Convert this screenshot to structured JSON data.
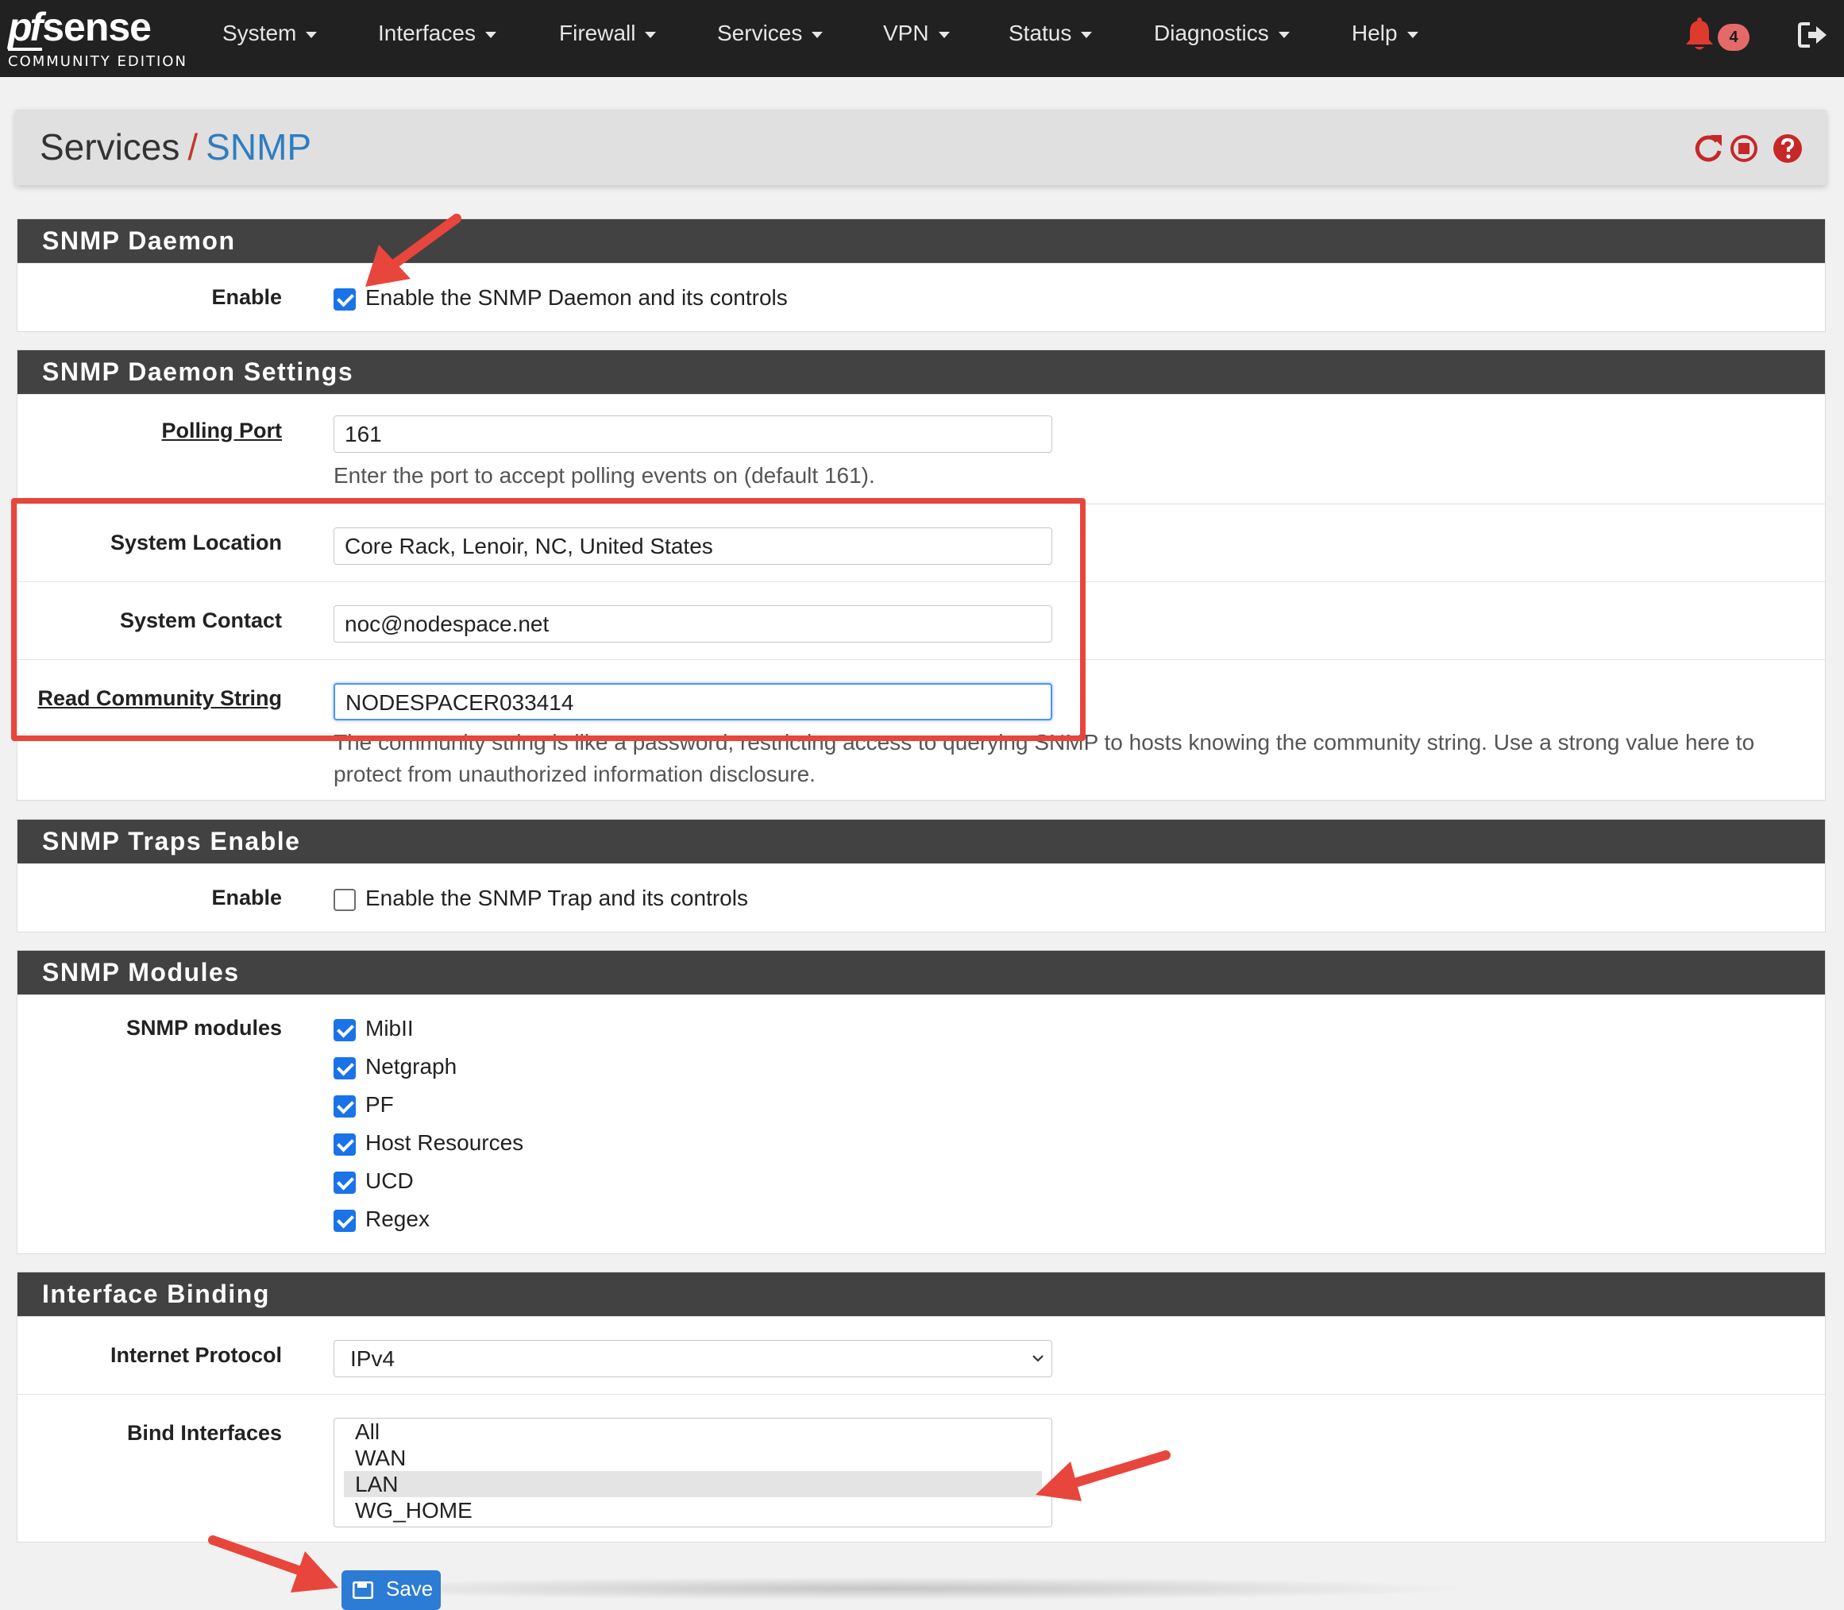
{
  "brand": {
    "logo_pf": "pf",
    "logo_sense": "sense",
    "edition": "COMMUNITY EDITION"
  },
  "nav": {
    "items": [
      "System",
      "Interfaces",
      "Firewall",
      "Services",
      "VPN",
      "Status",
      "Diagnostics",
      "Help"
    ],
    "notification_count": "4",
    "icons": {
      "bell": "bell-icon",
      "logout": "logout-icon"
    }
  },
  "header": {
    "crumb_section": "Services",
    "crumb_separator": "/",
    "crumb_page": "SNMP",
    "icons": [
      "restart-icon",
      "stop-icon",
      "help-icon"
    ]
  },
  "daemon": {
    "title": "SNMP Daemon",
    "enable_label": "Enable",
    "enable_text": "Enable the SNMP Daemon and its controls",
    "enabled": true
  },
  "settings": {
    "title": "SNMP Daemon Settings",
    "polling_port_label": "Polling Port",
    "polling_port_value": "161",
    "polling_port_help": "Enter the port to accept polling events on (default 161).",
    "location_label": "System Location",
    "location_value": "Core Rack, Lenoir, NC, United States",
    "contact_label": "System Contact",
    "contact_value": "noc@nodespace.net",
    "community_label": "Read Community String",
    "community_value": "NODESPACER033414",
    "community_help_1": "The community string is like a password, restricting access to querying SNMP to hosts knowing the community string. Use a strong value here to",
    "community_help_2": "protect from unauthorized information disclosure."
  },
  "traps": {
    "title": "SNMP Traps Enable",
    "enable_label": "Enable",
    "enable_text": "Enable the SNMP Trap and its controls",
    "enabled": false
  },
  "modules": {
    "title": "SNMP Modules",
    "label": "SNMP modules",
    "items": [
      "MibII",
      "Netgraph",
      "PF",
      "Host Resources",
      "UCD",
      "Regex"
    ],
    "checked": [
      true,
      true,
      true,
      true,
      true,
      true
    ]
  },
  "binding": {
    "title": "Interface Binding",
    "protocol_label": "Internet Protocol",
    "protocol_value": "IPv4",
    "bind_label": "Bind Interfaces",
    "bind_options": [
      "All",
      "WAN",
      "LAN",
      "WG_HOME"
    ],
    "bind_selected": "LAN"
  },
  "save_button": "Save",
  "colors": {
    "navbar": "#212121",
    "panel_head": "#424242",
    "link_blue": "#2e7dbf",
    "accent_red": "#e8453c",
    "check_blue": "#1a73e8"
  }
}
